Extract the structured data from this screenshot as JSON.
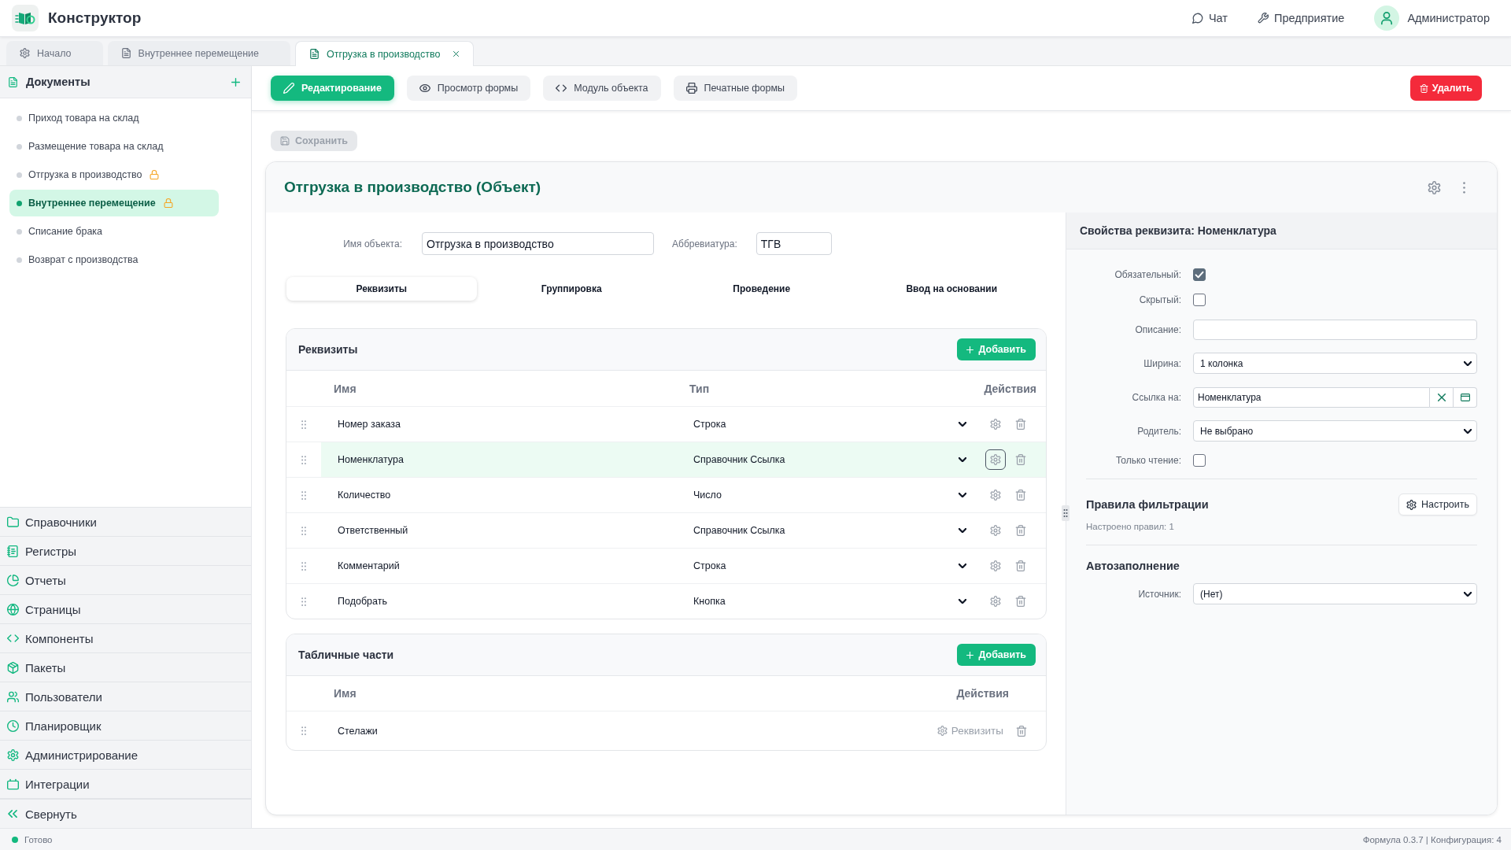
{
  "app": {
    "title": "Конструктор"
  },
  "header_links": [
    {
      "kind": "chat",
      "label": "Чат"
    },
    {
      "kind": "enterprise",
      "label": "Предприятие"
    }
  ],
  "user": {
    "name": "Администратор"
  },
  "tabs": [
    {
      "kind": "start",
      "label": "Начало",
      "selected": false,
      "closable": false
    },
    {
      "kind": "document",
      "label": "Внутреннее перемещение",
      "selected": false,
      "closable": false
    },
    {
      "kind": "document",
      "label": "Отгрузка в производство",
      "selected": true,
      "closable": true
    }
  ],
  "sidebar": {
    "section_title": "Документы",
    "items": [
      {
        "label": "Приход товара на склад",
        "selected": false,
        "locked": false
      },
      {
        "label": "Размещение товара на склад",
        "selected": false,
        "locked": false
      },
      {
        "label": "Отгрузка в производство",
        "selected": false,
        "locked": true
      },
      {
        "label": "Внутреннее перемещение",
        "selected": true,
        "locked": true
      },
      {
        "label": "Списание брака",
        "selected": false,
        "locked": false
      },
      {
        "label": "Возврат с производства",
        "selected": false,
        "locked": false
      }
    ],
    "groups": [
      {
        "kind": "catalogs",
        "label": "Справочники"
      },
      {
        "kind": "registers",
        "label": "Регистры"
      },
      {
        "kind": "reports",
        "label": "Отчеты"
      },
      {
        "kind": "pages",
        "label": "Страницы"
      },
      {
        "kind": "components",
        "label": "Компоненты"
      },
      {
        "kind": "packages",
        "label": "Пакеты"
      },
      {
        "kind": "users",
        "label": "Пользователи"
      },
      {
        "kind": "scheduler",
        "label": "Планировщик"
      },
      {
        "kind": "administration",
        "label": "Администрирование"
      },
      {
        "kind": "integrations",
        "label": "Интеграции"
      }
    ],
    "collapse": {
      "label": "Свернуть"
    }
  },
  "toolbar": {
    "modes": [
      {
        "kind": "edit",
        "label": "Редактирование",
        "selected": true
      },
      {
        "kind": "preview",
        "label": "Просмотр формы",
        "selected": false
      },
      {
        "kind": "code",
        "label": "Модуль объекта",
        "selected": false
      },
      {
        "kind": "print",
        "label": "Печатные формы",
        "selected": false
      }
    ],
    "delete_button": {
      "label": "Удалить"
    }
  },
  "save_button": {
    "label": "Сохранить",
    "disabled": true
  },
  "object": {
    "title": "Отгрузка в производство (Объект)",
    "name_label": "Имя объекта:",
    "name_value": "Отгрузка в производство",
    "abbreviation_label": "Аббревиатура:",
    "abbreviation_value": "ТГВ",
    "tabs": [
      {
        "label": "Реквизиты",
        "selected": true
      },
      {
        "label": "Группировка",
        "selected": false
      },
      {
        "label": "Проведение",
        "selected": false
      },
      {
        "label": "Ввод на основании",
        "selected": false
      }
    ],
    "attributes": {
      "title": "Реквизиты",
      "add_button": "Добавить",
      "columns": [
        "Имя",
        "Тип",
        "Действия"
      ],
      "rows": [
        {
          "name": "Номер заказа",
          "type": "Строка",
          "selected": false
        },
        {
          "name": "Номенклатура",
          "type": "Справочник Ссылка",
          "selected": true
        },
        {
          "name": "Количество",
          "type": "Число",
          "selected": false
        },
        {
          "name": "Ответственный",
          "type": "Справочник Ссылка",
          "selected": false
        },
        {
          "name": "Комментарий",
          "type": "Строка",
          "selected": false
        },
        {
          "name": "Подобрать",
          "type": "Кнопка",
          "selected": false
        }
      ]
    },
    "table_parts": {
      "title": "Табличные части",
      "add_button": "Добавить",
      "columns": [
        "Имя",
        "Действия"
      ],
      "rows": [
        {
          "name": "Стелажи",
          "action": "Реквизиты"
        }
      ]
    }
  },
  "properties": {
    "title": "Свойства реквизита: Номенклатура",
    "fields": [
      {
        "kind": "checkbox",
        "label": "Обязательный:",
        "checked": true
      },
      {
        "kind": "checkbox",
        "label": "Скрытый:",
        "checked": false
      },
      {
        "kind": "text",
        "label": "Описание:"
      },
      {
        "kind": "select",
        "label": "Ширина:",
        "value": "1 колонка"
      },
      {
        "kind": "reference",
        "label": "Ссылка на:",
        "value": "Номенклатура"
      },
      {
        "kind": "select",
        "label": "Родитель:",
        "value": "Не выбрано"
      },
      {
        "kind": "checkbox",
        "label": "Только чтение:",
        "checked": false
      }
    ],
    "filter": {
      "title": "Правила фильтрации",
      "button": "Настроить",
      "summary": "Настроено правил: 1"
    },
    "autofill": {
      "title": "Автозаполнение",
      "fields": [
        {
          "kind": "select",
          "label": "Источник:",
          "value": "(Нет)"
        }
      ]
    }
  },
  "status_bar": {
    "status": "Готово",
    "version": "Формула 0.3.7 | Конфигурация: 4"
  }
}
